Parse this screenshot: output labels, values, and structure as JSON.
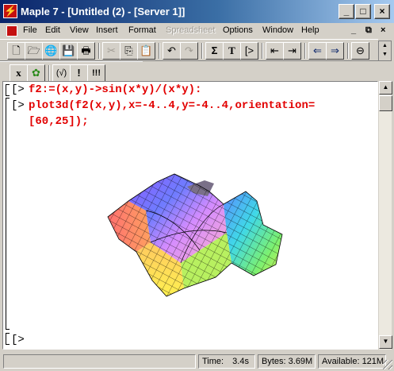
{
  "window": {
    "title": "Maple 7 - [Untitled (2) - [Server 1]]"
  },
  "menu": {
    "items": [
      {
        "label": "File",
        "enabled": true
      },
      {
        "label": "Edit",
        "enabled": true
      },
      {
        "label": "View",
        "enabled": true
      },
      {
        "label": "Insert",
        "enabled": true
      },
      {
        "label": "Format",
        "enabled": true
      },
      {
        "label": "Spreadsheet",
        "enabled": false
      },
      {
        "label": "Options",
        "enabled": true
      },
      {
        "label": "Window",
        "enabled": true
      },
      {
        "label": "Help",
        "enabled": true
      }
    ]
  },
  "toolbar2": {
    "x_label": "x",
    "group1_label": "(√)",
    "group2_label": "!",
    "group3_label": "!!!"
  },
  "worksheet": {
    "prompt_symbol": "[>",
    "lines": [
      "f2:=(x,y)->sin(x*y)/(x*y):",
      "plot3d(f2(x,y),x=-4..4,y=-4..4,orientation=",
      "[60,25]);"
    ]
  },
  "status": {
    "time_label": "Time:",
    "time_value": "3.4s",
    "bytes_label": "Bytes:",
    "bytes_value": "3.69M",
    "available_label": "Available:",
    "available_value": "121M"
  }
}
